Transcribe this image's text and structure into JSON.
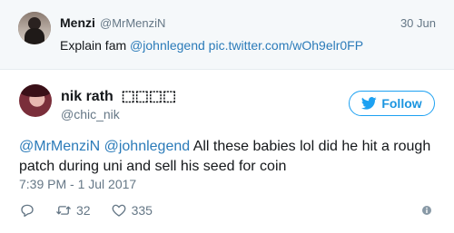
{
  "parent_tweet": {
    "name": "Menzi",
    "handle": "@MrMenziN",
    "date": "30 Jun",
    "text_prefix": "Explain fam ",
    "mention": "@johnlegend",
    "link": "pic.twitter.com/wOh9elr0FP"
  },
  "tweet": {
    "name": "nik rath  ⬚⬚⬚⬚",
    "handle": "@chic_nik",
    "follow_label": "Follow",
    "mention1": "@MrMenziN",
    "mention2": "@johnlegend",
    "text": " All these babies lol did he hit a rough patch during uni and sell his seed for coin",
    "timestamp": "7:39 PM - 1 Jul 2017",
    "retweets": "32",
    "likes": "335"
  },
  "colors": {
    "accent": "#1da1f2",
    "link": "#2b7bb9",
    "muted": "#657786",
    "parent_bg": "#f5f8fa"
  },
  "icons": {
    "reply": "reply-icon",
    "retweet": "retweet-icon",
    "like": "heart-icon",
    "info": "info-icon",
    "follow": "twitter-bird-icon"
  }
}
